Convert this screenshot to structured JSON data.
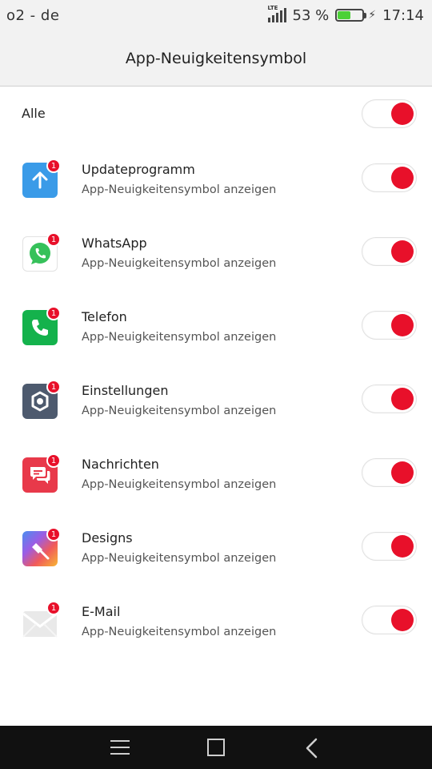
{
  "status_bar": {
    "carrier": "o2 - de",
    "network": "LTE",
    "battery_percent": "53 %",
    "battery_level": 0.53,
    "time": "17:14"
  },
  "header": {
    "title": "App-Neuigkeitensymbol"
  },
  "all_row": {
    "label": "Alle",
    "enabled": true
  },
  "apps": [
    {
      "name": "Updateprogramm",
      "subtitle": "App-Neuigkeitensymbol anzeigen",
      "badge": "1",
      "icon": "upload-arrow-icon",
      "enabled": true
    },
    {
      "name": "WhatsApp",
      "subtitle": "App-Neuigkeitensymbol anzeigen",
      "badge": "1",
      "icon": "whatsapp-icon",
      "enabled": true
    },
    {
      "name": "Telefon",
      "subtitle": "App-Neuigkeitensymbol anzeigen",
      "badge": "1",
      "icon": "phone-icon",
      "enabled": true
    },
    {
      "name": "Einstellungen",
      "subtitle": "App-Neuigkeitensymbol anzeigen",
      "badge": "1",
      "icon": "settings-gear-icon",
      "enabled": true
    },
    {
      "name": "Nachrichten",
      "subtitle": "App-Neuigkeitensymbol anzeigen",
      "badge": "1",
      "icon": "messages-icon",
      "enabled": true
    },
    {
      "name": "Designs",
      "subtitle": "App-Neuigkeitensymbol anzeigen",
      "badge": "1",
      "icon": "themes-brush-icon",
      "enabled": true
    },
    {
      "name": "E-Mail",
      "subtitle": "App-Neuigkeitensymbol anzeigen",
      "badge": "1",
      "icon": "email-envelope-icon",
      "enabled": true
    }
  ],
  "colors": {
    "toggle_on": "#e8102a",
    "badge": "#e8102a",
    "header_bg": "#f2f2f2",
    "nav_bg": "#111111"
  },
  "nav_bar": {
    "icons": [
      "menu-icon",
      "home-icon",
      "back-icon"
    ]
  }
}
